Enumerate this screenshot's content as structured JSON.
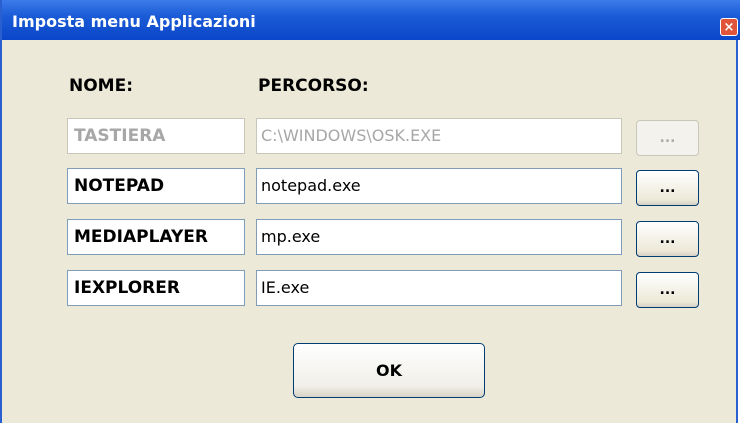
{
  "window": {
    "title": "Imposta menu Applicazioni",
    "close_symbol": "×"
  },
  "headers": {
    "name": "NOME:",
    "path": "PERCORSO:"
  },
  "rows": [
    {
      "name": "TASTIERA",
      "path": "C:\\WINDOWS\\OSK.EXE",
      "browse": "...",
      "enabled": false
    },
    {
      "name": "NOTEPAD",
      "path": "notepad.exe",
      "browse": "...",
      "enabled": true
    },
    {
      "name": "MEDIAPLAYER",
      "path": "mp.exe",
      "browse": "...",
      "enabled": true
    },
    {
      "name": "IEXPLORER",
      "path": "IE.exe",
      "browse": "...",
      "enabled": true
    }
  ],
  "ok_label": "OK",
  "colors": {
    "titlebar": "#0a46c9",
    "dialog_bg": "#ece9d8",
    "close": "#e0543a",
    "disabled_text": "#a7a7a7"
  },
  "icons": {
    "close": "close-icon"
  }
}
